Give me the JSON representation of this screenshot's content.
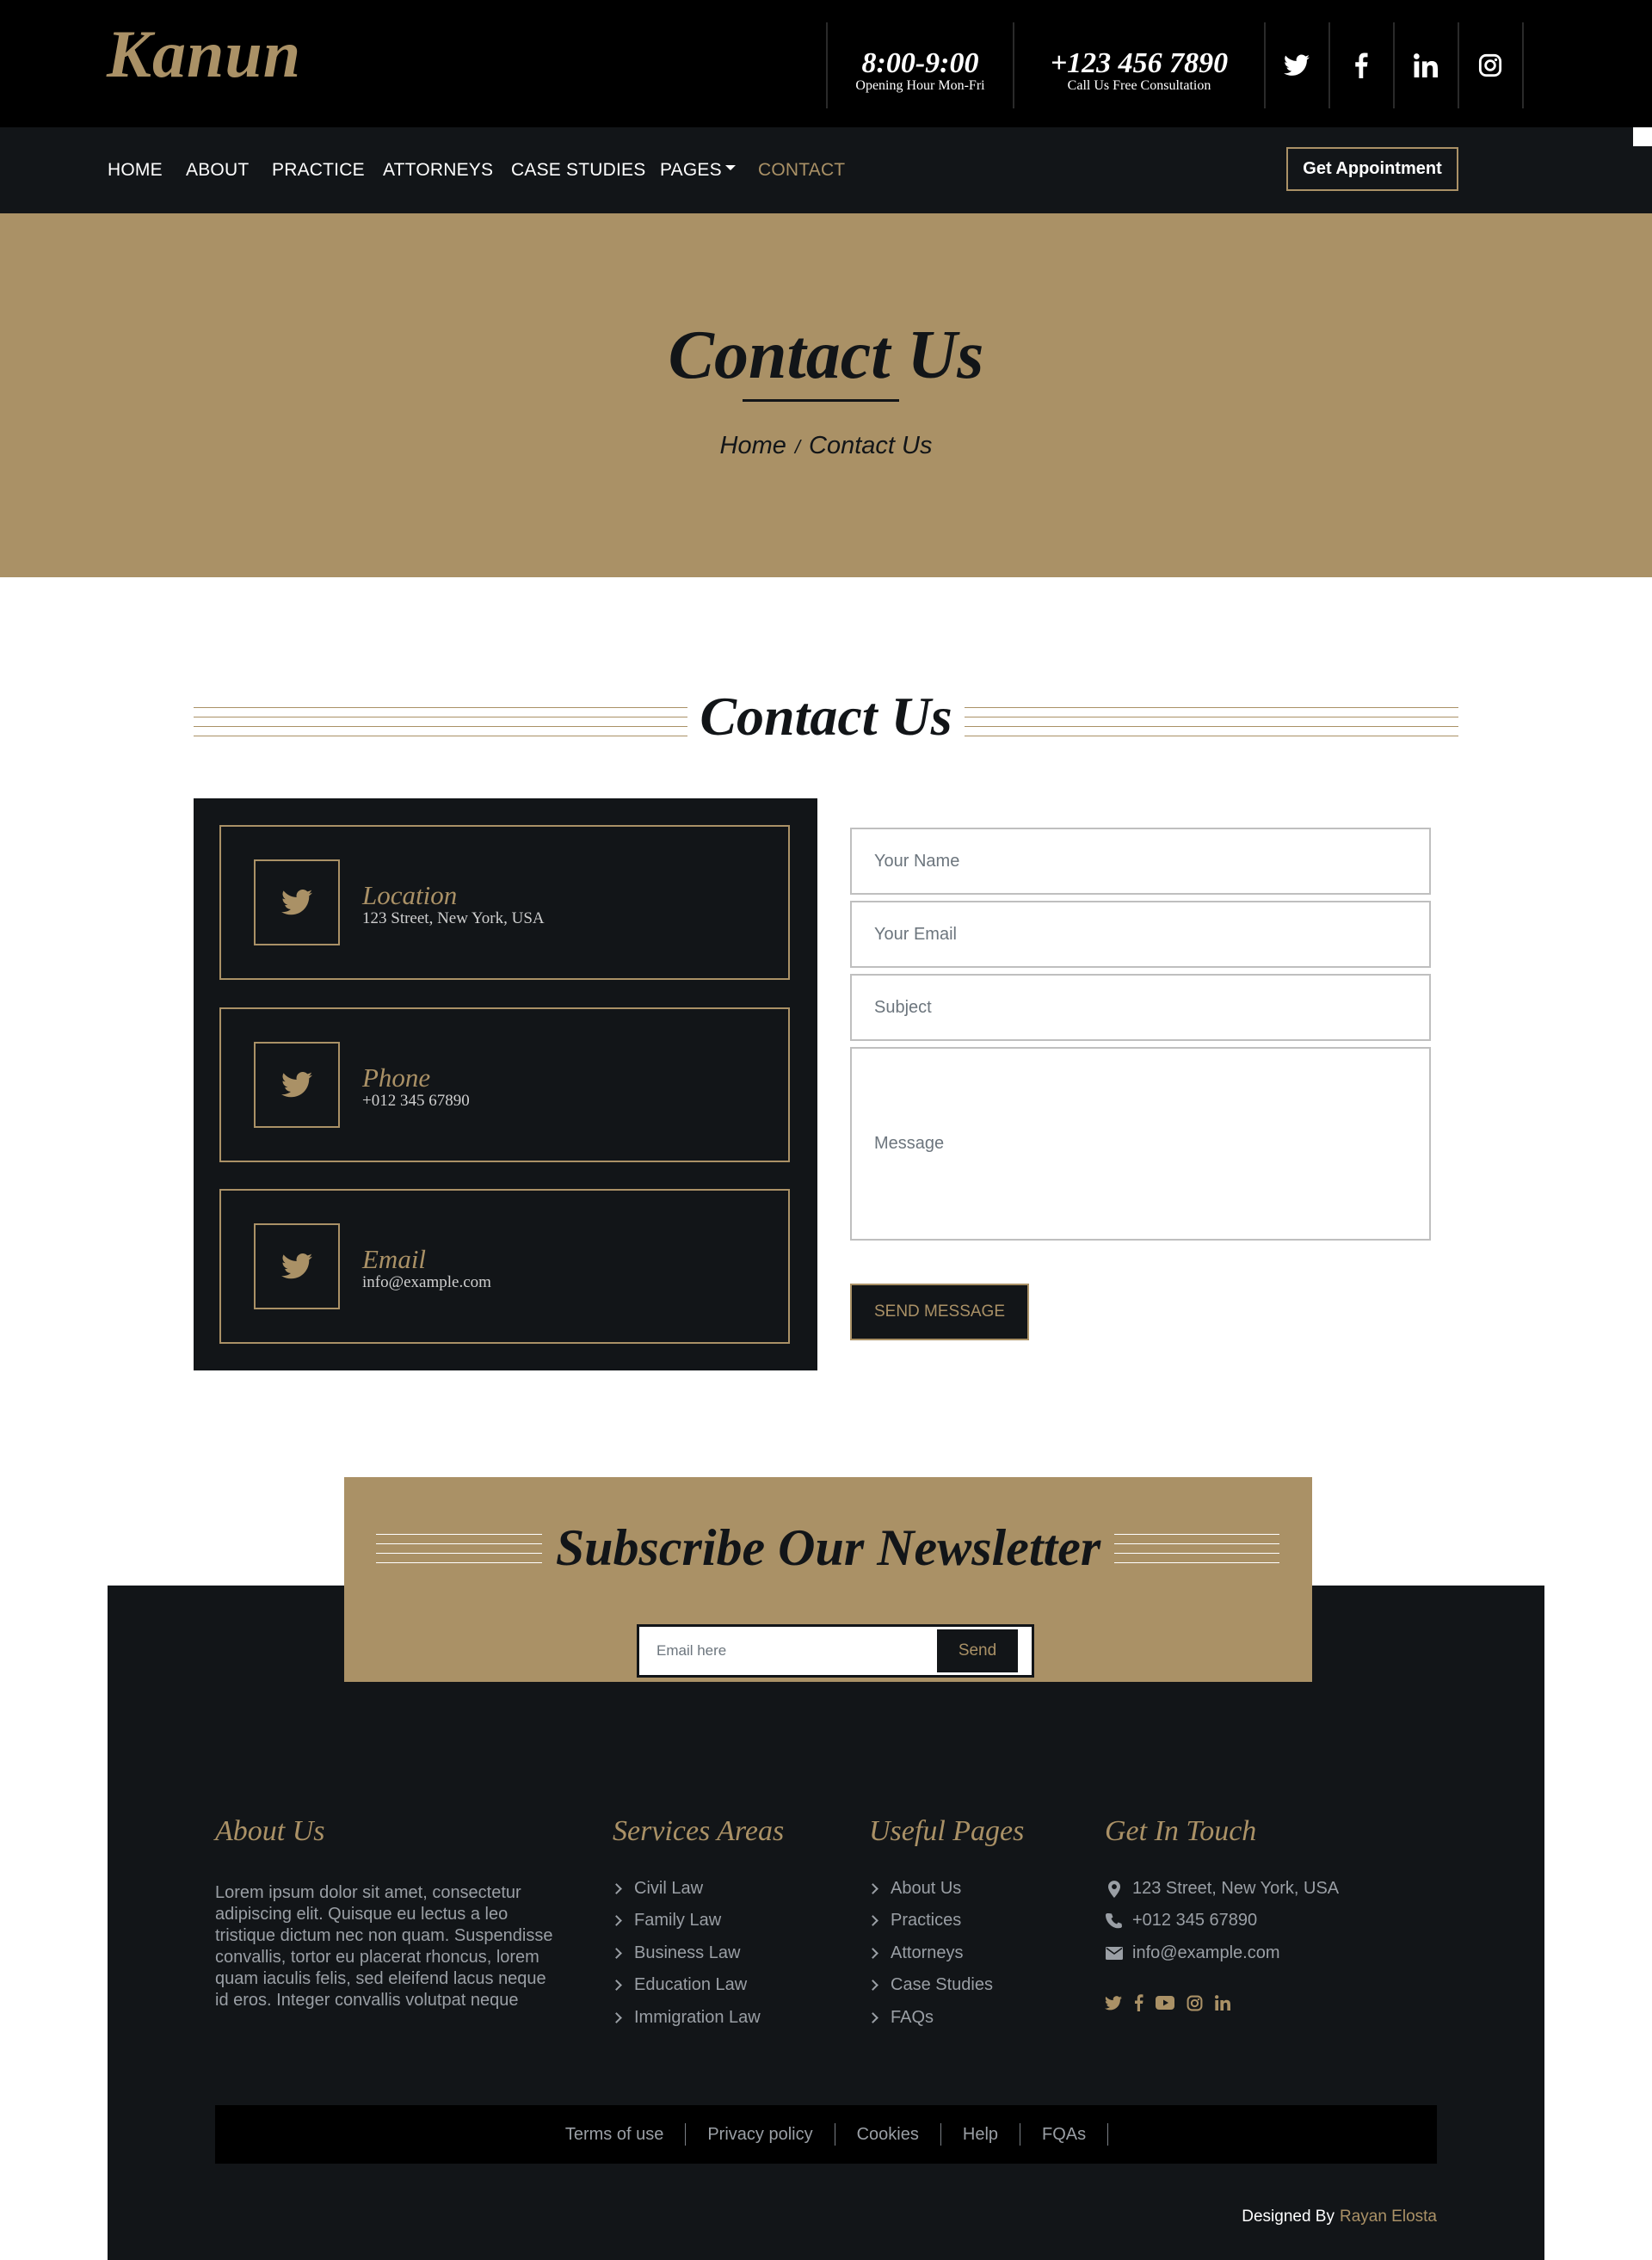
{
  "brand": {
    "logo": "Kanun",
    "accent": "#aa9166",
    "dark": "#121518"
  },
  "topbar": {
    "hours": {
      "big": "8:00-9:00",
      "small": "Opening Hour Mon-Fri"
    },
    "phone": {
      "big": "+123 456 7890",
      "small": "Call Us Free Consultation"
    },
    "social": [
      "twitter-icon",
      "facebook-icon",
      "linkedin-icon",
      "instagram-icon"
    ]
  },
  "nav": {
    "items": [
      "HOME",
      "ABOUT",
      "PRACTICE",
      "ATTORNEYS",
      "CASE STUDIES",
      "PAGES",
      "CONTACT"
    ],
    "active": "CONTACT",
    "cta": "Get Appointment"
  },
  "page_header": {
    "title": "Contact Us",
    "breadcrumb": [
      "Home",
      "Contact Us"
    ],
    "separator": "/"
  },
  "contact": {
    "section_title": "Contact Us",
    "cards": [
      {
        "title": "Location",
        "value": "123 Street, New York, USA"
      },
      {
        "title": "Phone",
        "value": "+012 345 67890"
      },
      {
        "title": "Email",
        "value": "info@example.com"
      }
    ],
    "form": {
      "name_placeholder": "Your Name",
      "email_placeholder": "Your Email",
      "subject_placeholder": "Subject",
      "message_placeholder": "Message",
      "submit": "SEND MESSAGE"
    }
  },
  "newsletter": {
    "title": "Subscribe Our Newsletter",
    "placeholder": "Email here",
    "button": "Send"
  },
  "footer": {
    "about": {
      "title": "About Us",
      "text": "Lorem ipsum dolor sit amet, consectetur adipiscing elit. Quisque eu lectus a leo tristique dictum nec non quam. Suspendisse convallis, tortor eu placerat rhoncus, lorem quam iaculis felis, sed eleifend lacus neque id eros. Integer convallis volutpat neque"
    },
    "services": {
      "title": "Services Areas",
      "items": [
        "Civil Law",
        "Family Law",
        "Business Law",
        "Education Law",
        "Immigration Law"
      ]
    },
    "pages": {
      "title": "Useful Pages",
      "items": [
        "About Us",
        "Practices",
        "Attorneys",
        "Case Studies",
        "FAQs"
      ]
    },
    "touch": {
      "title": "Get In Touch",
      "address": "123 Street, New York, USA",
      "phone": "+012 345 67890",
      "email": "info@example.com",
      "social": [
        "twitter-icon",
        "facebook-icon",
        "youtube-icon",
        "instagram-icon",
        "linkedin-icon"
      ]
    },
    "bottom_links": [
      "Terms of use",
      "Privacy policy",
      "Cookies",
      "Help",
      "FQAs"
    ],
    "credit_label": "Designed By",
    "credit_name": "Rayan Elosta"
  }
}
